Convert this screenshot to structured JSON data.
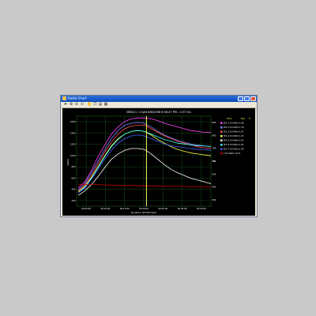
{
  "window": {
    "title": "Radio Chart"
  },
  "toolbar": {
    "icons": [
      "arrow-icon",
      "zoom-in-icon",
      "zoom-out-icon",
      "zoom-fit-icon",
      "separator",
      "hand-icon",
      "copy-icon",
      "print-icon",
      "grid-icon"
    ]
  },
  "chart_data": {
    "type": "line",
    "title": "MSK(1): 1 light 8/6/2006 6:56:47 PM - 0.57 hrs",
    "xlabel": "Duration (Hr:Min:Sec)",
    "ylabel": "kW/m",
    "y2label": "%",
    "grid": true,
    "legend_placement": "top-right",
    "legend_header": [
      "Trace",
      "Max",
      "H"
    ],
    "x_ticks": [
      "00:05:00",
      "00:10:00",
      "00:15:00",
      "00:20:00",
      "00:25:00",
      "00:30:00",
      "00:35:00"
    ],
    "y_ticks": [
      "1600",
      "1400",
      "1200",
      "1000",
      "800",
      "600",
      "400",
      "200"
    ],
    "y2_ticks": [
      "900",
      "800",
      "700",
      "600",
      "500",
      "400",
      "300"
    ],
    "cursor_x": 0.52,
    "series": [
      {
        "name": "EC1-1  0.0  kW/m  1.86",
        "color": "#ff40ff",
        "values": [
          0.2,
          0.27,
          0.4,
          0.55,
          0.68,
          0.8,
          0.88,
          0.94,
          0.97,
          0.98,
          0.98,
          0.97,
          0.95,
          0.92,
          0.9,
          0.88,
          0.86,
          0.84,
          0.83,
          0.82,
          0.82
        ]
      },
      {
        "name": "EC1-2  0.0  kW/m  1.76",
        "color": "#8080ff",
        "values": [
          0.18,
          0.25,
          0.37,
          0.5,
          0.63,
          0.75,
          0.84,
          0.9,
          0.92,
          0.93,
          0.92,
          0.88,
          0.83,
          0.79,
          0.76,
          0.73,
          0.71,
          0.69,
          0.68,
          0.67,
          0.66
        ]
      },
      {
        "name": "EC1-3  0.0  kW/m  1.67",
        "color": "#ff5050",
        "values": [
          0.17,
          0.23,
          0.34,
          0.47,
          0.6,
          0.71,
          0.8,
          0.86,
          0.89,
          0.9,
          0.9,
          0.86,
          0.82,
          0.78,
          0.75,
          0.72,
          0.7,
          0.68,
          0.66,
          0.65,
          0.64
        ]
      },
      {
        "name": "EC1-4  0.0  kW/m  1.67",
        "color": "#ffff40",
        "values": [
          0.16,
          0.22,
          0.32,
          0.44,
          0.56,
          0.67,
          0.75,
          0.8,
          0.83,
          0.84,
          0.83,
          0.79,
          0.74,
          0.7,
          0.66,
          0.63,
          0.61,
          0.59,
          0.58,
          0.57,
          0.56
        ]
      },
      {
        "name": "EC1-5  0.0  kW/m  1.61",
        "color": "#ffffff",
        "values": [
          0.12,
          0.17,
          0.24,
          0.33,
          0.43,
          0.52,
          0.58,
          0.62,
          0.64,
          0.64,
          0.63,
          0.58,
          0.52,
          0.46,
          0.41,
          0.37,
          0.34,
          0.31,
          0.29,
          0.27,
          0.25
        ]
      },
      {
        "name": "EC1-6  0.0  kW/m  1.55",
        "color": "#40ffff",
        "values": [
          0.15,
          0.21,
          0.31,
          0.43,
          0.55,
          0.66,
          0.74,
          0.8,
          0.83,
          0.84,
          0.83,
          0.8,
          0.77,
          0.74,
          0.72,
          0.7,
          0.69,
          0.68,
          0.67,
          0.67,
          0.66
        ]
      },
      {
        "name": "EC1-7  0.0  kW/m  1.49",
        "color": "#4060ff",
        "values": [
          0.15,
          0.2,
          0.3,
          0.41,
          0.52,
          0.62,
          0.7,
          0.75,
          0.78,
          0.79,
          0.78,
          0.75,
          0.72,
          0.69,
          0.67,
          0.66,
          0.65,
          0.64,
          0.63,
          0.63,
          0.62
        ]
      },
      {
        "name": "T  0.0  kW/m  19.71",
        "color": "#c00000",
        "values": [
          0.24,
          0.24,
          0.24,
          0.24,
          0.235,
          0.235,
          0.23,
          0.23,
          0.23,
          0.23,
          0.225,
          0.225,
          0.225,
          0.22,
          0.22,
          0.22,
          0.22,
          0.215,
          0.215,
          0.215,
          0.21
        ]
      }
    ]
  }
}
